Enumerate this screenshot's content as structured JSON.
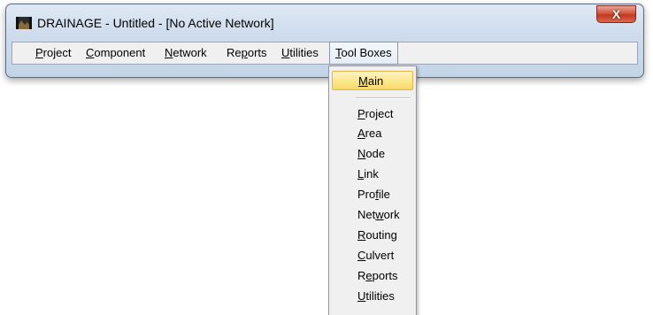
{
  "window": {
    "title": "DRAINAGE - Untitled - [No Active Network]",
    "close_label": "X"
  },
  "menubar": {
    "items": [
      {
        "pre": "",
        "key": "P",
        "post": "roject"
      },
      {
        "pre": "",
        "key": "C",
        "post": "omponent"
      },
      {
        "pre": "",
        "key": "N",
        "post": "etwork"
      },
      {
        "pre": "Re",
        "key": "p",
        "post": "orts"
      },
      {
        "pre": "",
        "key": "U",
        "post": "tilities"
      },
      {
        "pre": "",
        "key": "T",
        "post": "ool Boxes"
      }
    ]
  },
  "dropdown": {
    "items": [
      {
        "pre": "",
        "key": "M",
        "post": "ain"
      },
      {
        "pre": "",
        "key": "P",
        "post": "roject"
      },
      {
        "pre": "",
        "key": "A",
        "post": "rea"
      },
      {
        "pre": "",
        "key": "N",
        "post": "ode"
      },
      {
        "pre": "",
        "key": "L",
        "post": "ink"
      },
      {
        "pre": "Pro",
        "key": "f",
        "post": "ile"
      },
      {
        "pre": "Net",
        "key": "w",
        "post": "ork"
      },
      {
        "pre": "",
        "key": "R",
        "post": "outing"
      },
      {
        "pre": "",
        "key": "C",
        "post": "ulvert"
      },
      {
        "pre": "R",
        "key": "e",
        "post": "ports"
      },
      {
        "pre": "",
        "key": "U",
        "post": "tilities"
      }
    ]
  },
  "colors": {
    "highlight": "#fde88f",
    "close_button": "#c3371f",
    "title_bar": "#cfdcec"
  },
  "icons": {
    "app": "drainage-app-icon",
    "close": "close-icon"
  }
}
